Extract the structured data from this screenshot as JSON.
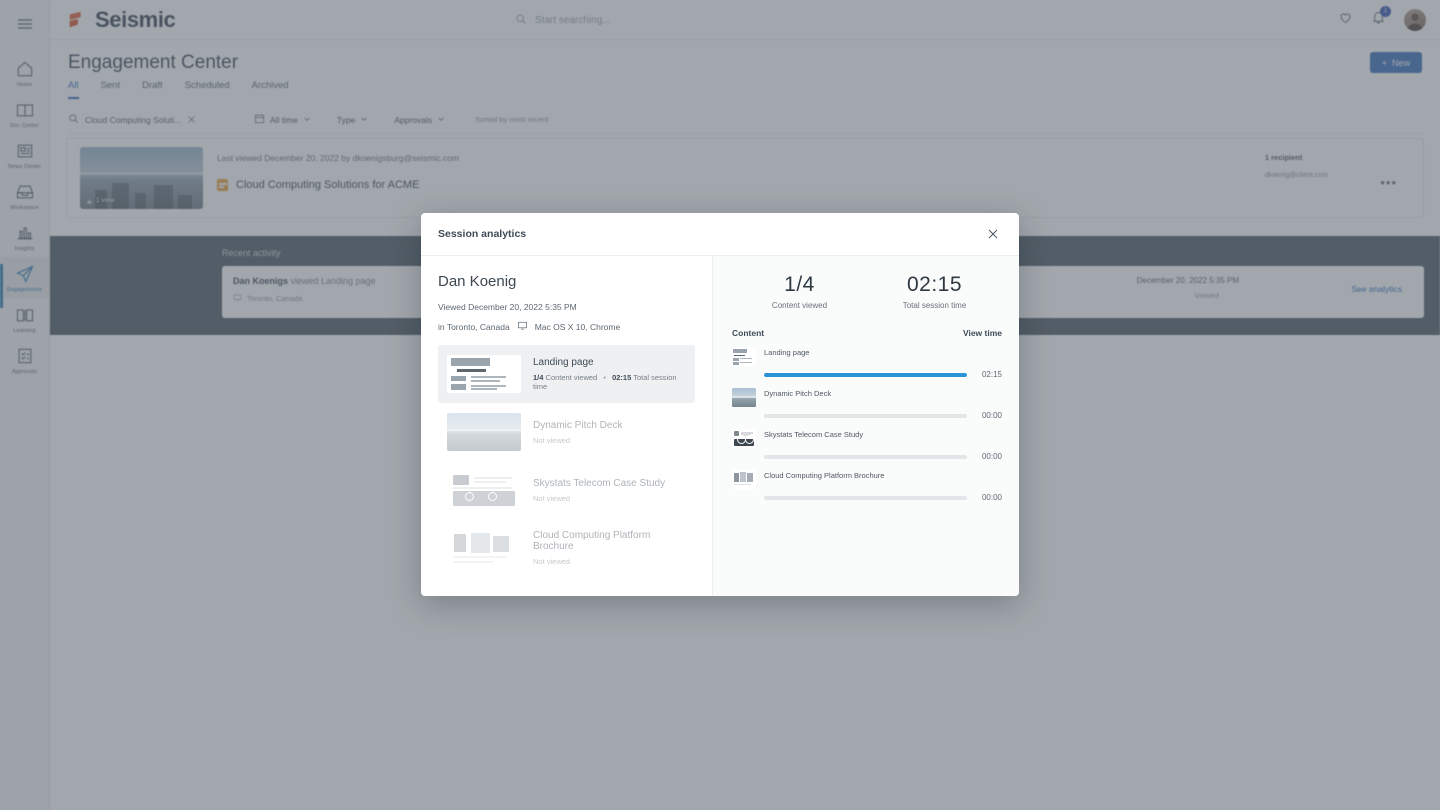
{
  "app": {
    "brand": "Seismic",
    "search_placeholder": "Start searching...",
    "notification_count": "1"
  },
  "rail": {
    "items": [
      {
        "label": "Home",
        "icon": "home-icon",
        "active": false
      },
      {
        "label": "Doc Center",
        "icon": "doc-center-icon",
        "active": false
      },
      {
        "label": "News Center",
        "icon": "news-center-icon",
        "active": false
      },
      {
        "label": "Workspace",
        "icon": "workspace-icon",
        "active": false
      },
      {
        "label": "Insights",
        "icon": "insights-icon",
        "active": false
      },
      {
        "label": "Engagements",
        "icon": "engagements-icon",
        "active": true
      },
      {
        "label": "Learning",
        "icon": "learning-icon",
        "active": false
      },
      {
        "label": "Approvals",
        "icon": "approvals-icon",
        "active": false
      }
    ]
  },
  "page": {
    "title": "Engagement Center",
    "new_button": "New",
    "tabs": [
      {
        "label": "All",
        "active": true
      },
      {
        "label": "Sent",
        "active": false
      },
      {
        "label": "Draft",
        "active": false
      },
      {
        "label": "Scheduled",
        "active": false
      },
      {
        "label": "Archived",
        "active": false
      }
    ],
    "filters": {
      "search_value": "Cloud Computing Soluti...",
      "date_filter": "All time",
      "type_filter": "Type",
      "approvals_filter": "Approvals",
      "sort_label": "Sorted by most recent"
    },
    "card": {
      "views_label": "1 view",
      "meta": "Last viewed December 20, 2022 by dkoenigsburg@seismic.com",
      "title": "Cloud Computing Solutions for ACME",
      "recipient_count": "1 recipient",
      "recipient_email": "dkoenig@client.com",
      "kebab": "•••"
    },
    "recent_activity": {
      "heading": "Recent activity",
      "actor": "Dan Koenigs",
      "action": " viewed Landing page",
      "location": "Toronto, Canada",
      "timestamp": "December 20, 2022 5:35 PM",
      "status": "Viewed",
      "link": "See analytics"
    }
  },
  "modal": {
    "title": "Session analytics",
    "person": "Dan Koenig",
    "viewed_line": "Viewed December 20, 2022 5:35 PM",
    "location_line": "in Toronto, Canada",
    "device_line": "Mac OS X 10, Chrome",
    "stats": [
      {
        "value": "1/4",
        "label": "Content viewed"
      },
      {
        "value": "02:15",
        "label": "Total session time"
      }
    ],
    "view_header": {
      "content": "Content",
      "view_time": "View time"
    },
    "content_items": [
      {
        "title": "Landing page",
        "selected": true,
        "thumb": "wireframe",
        "count": "1/4",
        "count_label": "Content viewed",
        "time": "02:15",
        "time_label": "Total session time",
        "status": ""
      },
      {
        "title": "Dynamic Pitch Deck",
        "selected": false,
        "thumb": "photo",
        "count": "",
        "count_label": "",
        "time": "",
        "time_label": "",
        "status": "Not viewed"
      },
      {
        "title": "Skystats Telecom Case Study",
        "selected": false,
        "thumb": "case",
        "count": "",
        "count_label": "",
        "time": "",
        "time_label": "",
        "status": "Not viewed"
      },
      {
        "title": "Cloud Computing Platform Brochure",
        "selected": false,
        "thumb": "brochure",
        "count": "",
        "count_label": "",
        "time": "",
        "time_label": "",
        "status": "Not viewed"
      }
    ],
    "view_rows": [
      {
        "name": "Landing page",
        "time": "02:15",
        "percent": 100,
        "thumb": "wireframe"
      },
      {
        "name": "Dynamic Pitch Deck",
        "time": "00:00",
        "percent": 0,
        "thumb": "photo"
      },
      {
        "name": "Skystats Telecom Case Study",
        "time": "00:00",
        "percent": 0,
        "thumb": "case"
      },
      {
        "name": "Cloud Computing Platform Brochure",
        "time": "00:00",
        "percent": 0,
        "thumb": "brochure"
      }
    ]
  },
  "colors": {
    "brand_orange": "#e2633c",
    "accent_blue": "#2a94d6",
    "link_blue": "#2f6bbf",
    "band_dark": "#505b65"
  }
}
